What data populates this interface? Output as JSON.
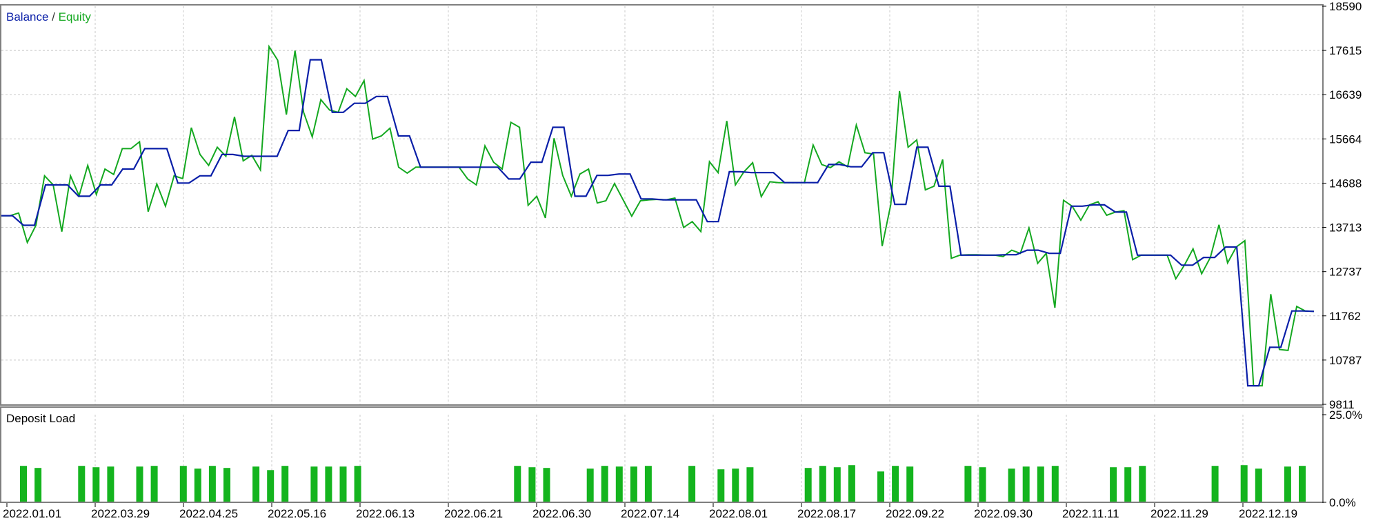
{
  "legend": {
    "balance": "Balance",
    "separator": " / ",
    "equity": "Equity"
  },
  "load_panel": {
    "title": "Deposit Load"
  },
  "colors": {
    "balance": "#0a1fa8",
    "equity": "#14a820",
    "bars": "#14b41e",
    "grid": "#c8c8c8",
    "frame": "#7f7f7f"
  },
  "chart_data": [
    {
      "type": "line",
      "y_ticks": [
        "18590",
        "17615",
        "16639",
        "15664",
        "14688",
        "13713",
        "12737",
        "11762",
        "10787",
        "9811"
      ],
      "ylim": [
        9811,
        18590
      ],
      "x_ticks": [
        "2022.01.01",
        "2022.03.29",
        "2022.04.25",
        "2022.05.16",
        "2022.06.13",
        "2022.06.21",
        "2022.06.30",
        "2022.07.14",
        "2022.08.01",
        "2022.08.17",
        "2022.09.22",
        "2022.09.30",
        "2022.11.11",
        "2022.11.29",
        "2022.12.19"
      ],
      "x_index": [
        0,
        1,
        2,
        3,
        4,
        5,
        6,
        7,
        8,
        9,
        10,
        11,
        12,
        13,
        14,
        15,
        16,
        17,
        18,
        19,
        20,
        21,
        22,
        23,
        24,
        25,
        26,
        27,
        28,
        29,
        30,
        31,
        32,
        33,
        34,
        35,
        36,
        37,
        38,
        39,
        40,
        41,
        42,
        43,
        44,
        45,
        46,
        47,
        48,
        49,
        50,
        51,
        52,
        53,
        54,
        55,
        56,
        57,
        58,
        59,
        60,
        61,
        62,
        63,
        64,
        65,
        66,
        67,
        68,
        69,
        70,
        71,
        72,
        73,
        74,
        75,
        76,
        77,
        78,
        79,
        80,
        81,
        82,
        83,
        84,
        85,
        86,
        87,
        88,
        89,
        90,
        91,
        92,
        93,
        94,
        95,
        96,
        97,
        98,
        99,
        100,
        101,
        102,
        103,
        104,
        105,
        106,
        107,
        108,
        109,
        110,
        111,
        112,
        113,
        114,
        115,
        116
      ],
      "series": [
        {
          "name": "Balance",
          "values": [
            13970,
            13970,
            13760,
            13760,
            14650,
            14650,
            14650,
            14400,
            14400,
            14650,
            14650,
            15000,
            15000,
            15450,
            15450,
            15450,
            14690,
            14690,
            14850,
            14850,
            15320,
            15320,
            15280,
            15280,
            15280,
            15280,
            15850,
            15850,
            17410,
            17410,
            16250,
            16250,
            16450,
            16450,
            16600,
            16600,
            15730,
            15730,
            15040,
            15040,
            15040,
            15040,
            15040,
            15040,
            15040,
            15040,
            14780,
            14780,
            15150,
            15150,
            15920,
            15920,
            14400,
            14400,
            14860,
            14860,
            14890,
            14890,
            14340,
            14340,
            14320,
            14320,
            14320,
            14320,
            13840,
            13840,
            14940,
            14940,
            14920,
            14920,
            14920,
            14700,
            14700,
            14700,
            14700,
            15100,
            15100,
            15050,
            15050,
            15360,
            15360,
            14220,
            14220,
            15480,
            15480,
            14620,
            14620,
            13100,
            13100,
            13100,
            13100,
            13110,
            13110,
            13210,
            13210,
            13140,
            13140,
            14180,
            14180,
            14210,
            14210,
            14050,
            14050,
            13100,
            13100,
            13100,
            13100,
            12880,
            12880,
            13050,
            13050,
            13280,
            13280,
            10220,
            10220,
            11070,
            11070,
            11870,
            11870,
            11860
          ]
        },
        {
          "name": "Equity",
          "values": [
            13970,
            13970,
            14030,
            13380,
            13760,
            14850,
            14650,
            13620,
            14850,
            14410,
            15080,
            14440,
            15000,
            14880,
            15450,
            15450,
            15600,
            14060,
            14670,
            14180,
            14850,
            14790,
            15910,
            15320,
            15080,
            15480,
            15280,
            16150,
            15180,
            15300,
            14980,
            17700,
            17400,
            16200,
            17610,
            16250,
            15710,
            16530,
            16300,
            16250,
            16770,
            16600,
            16950,
            15660,
            15730,
            15900,
            15040,
            14910,
            15040,
            15040,
            15040,
            15040,
            15040,
            15040,
            14780,
            14650,
            15510,
            15150,
            15000,
            16030,
            15920,
            14200,
            14400,
            13920,
            15680,
            14860,
            14400,
            14890,
            15000,
            14250,
            14300,
            14680,
            14320,
            13960,
            14300,
            14320,
            14330,
            14320,
            14360,
            13710,
            13840,
            13620,
            15160,
            14920,
            16060,
            14650,
            14940,
            15140,
            14390,
            14720,
            14700,
            14700,
            14700,
            14700,
            15530,
            15100,
            15030,
            15160,
            15050,
            15970,
            15360,
            15330,
            13300,
            14220,
            16720,
            15480,
            15640,
            14540,
            14620,
            15210,
            13030,
            13100,
            13110,
            13110,
            13100,
            13100,
            13070,
            13210,
            13140,
            13700,
            12920,
            13140,
            11940,
            14310,
            14180,
            13870,
            14210,
            14280,
            13980,
            14050,
            14080,
            13000,
            13100,
            13100,
            13100,
            13100,
            12580,
            12880,
            13240,
            12690,
            13050,
            13770,
            12930,
            13280,
            13420,
            10220,
            10220,
            12240,
            11020,
            11000,
            11970,
            11870,
            11860
          ]
        }
      ]
    },
    {
      "type": "bar",
      "title": "Deposit Load",
      "y_ticks": [
        "25.0%",
        "0.0%"
      ],
      "ylim": [
        0,
        25
      ],
      "values": [
        10.4,
        9.8,
        0,
        0,
        10.4,
        10.0,
        10.2,
        0,
        10.2,
        10.4,
        0,
        10.4,
        9.6,
        10.4,
        9.8,
        0,
        10.2,
        9.2,
        10.4,
        0,
        10.2,
        10.2,
        10.2,
        10.4,
        0,
        0,
        0,
        0,
        0,
        0,
        0,
        0,
        0,
        0,
        10.4,
        10.0,
        9.8,
        0,
        0,
        9.6,
        10.4,
        10.2,
        10.2,
        10.4,
        0,
        0,
        10.4,
        0,
        9.4,
        9.6,
        10.0,
        0,
        0,
        0,
        9.8,
        10.4,
        10.0,
        10.6,
        0,
        8.8,
        10.4,
        10.2,
        0,
        0,
        0,
        10.4,
        10.0,
        0,
        9.6,
        10.2,
        10.2,
        10.4,
        0,
        0,
        0,
        10.0,
        10.0,
        10.4,
        0,
        0,
        0,
        0,
        10.4,
        0,
        10.6,
        9.6,
        0,
        10.2,
        10.4
      ]
    }
  ]
}
